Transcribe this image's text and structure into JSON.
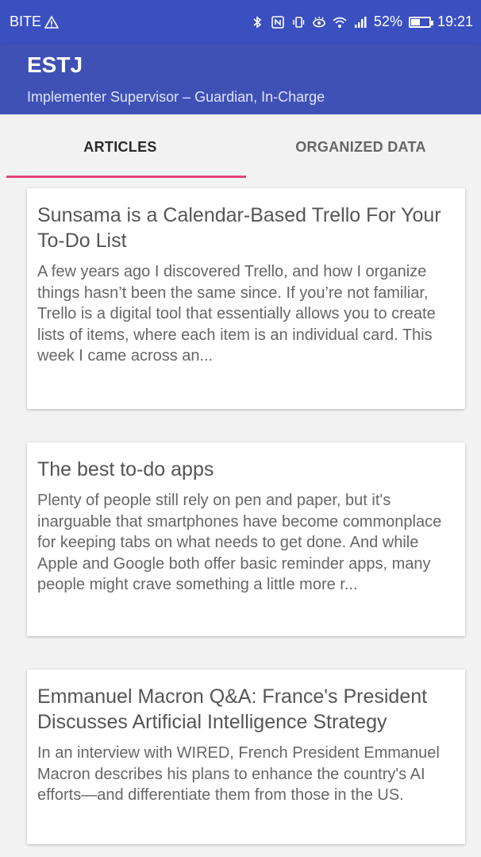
{
  "status_bar": {
    "carrier": "BITE",
    "battery_percent_text": "52%",
    "battery_level": 0.52,
    "time": "19:21"
  },
  "app_bar": {
    "title": "ESTJ",
    "subtitle": "Implementer Supervisor – Guardian, In-Charge"
  },
  "tabs": [
    {
      "label": "ARTICLES",
      "selected": true
    },
    {
      "label": "ORGANIZED DATA",
      "selected": false
    }
  ],
  "articles": [
    {
      "title": "Sunsama is a Calendar-Based Trello For Your To-Do List",
      "excerpt": "A few years ago I discovered Trello, and how I organize things hasn’t been the same since. If you’re not familiar, Trello is a digital tool that essentially allows you to create lists of items, where each item is an individual card. This week I came across an..."
    },
    {
      "title": "The best to-do apps",
      "excerpt": "Plenty of people still rely on pen and paper, but it's inarguable that smartphones have become commonplace for keeping tabs on what needs to get done. And while Apple and Google both offer basic reminder apps, many people might crave something a little more r..."
    },
    {
      "title": "Emmanuel Macron Q&A: France's President Discusses Artificial Intelligence Strategy",
      "excerpt": "In an interview with WIRED, French President Emmanuel Macron describes his plans to enhance the country's AI efforts—and differentiate them from those in the US."
    }
  ],
  "colors": {
    "primary": "#3f51b5",
    "status_bar": "#3a4fc0",
    "accent": "#e0457b"
  }
}
